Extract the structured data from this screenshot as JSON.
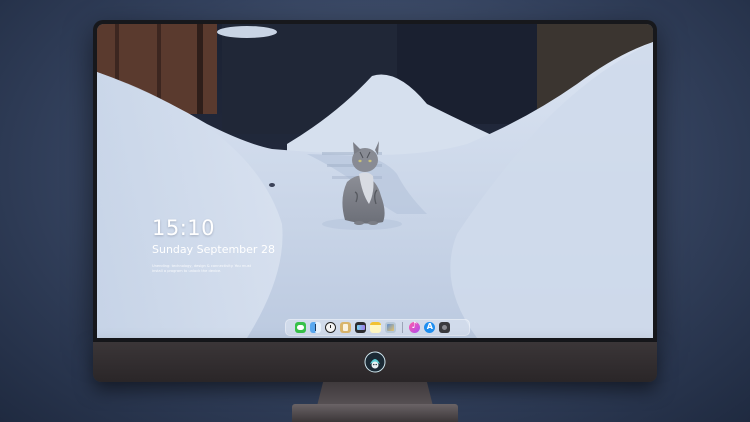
{
  "lock_screen": {
    "time": "15:10",
    "date": "Sunday September 28",
    "notice": "Unending: technology, design & connectivity. You must install a program to unlock the device."
  },
  "dock": {
    "apps": [
      {
        "name": "Messages",
        "icon": "messages-icon"
      },
      {
        "name": "Finder",
        "icon": "finder-icon"
      },
      {
        "name": "Clock",
        "icon": "clock-icon"
      },
      {
        "name": "Contacts",
        "icon": "contacts-icon"
      },
      {
        "name": "Final Cut Pro",
        "icon": "final-cut-icon"
      },
      {
        "name": "Notes",
        "icon": "notes-icon"
      },
      {
        "name": "Preview",
        "icon": "preview-icon"
      },
      {
        "name": "Music",
        "icon": "music-icon"
      },
      {
        "name": "App Store",
        "icon": "app-store-icon"
      },
      {
        "name": "Camera",
        "icon": "camera-icon"
      }
    ]
  },
  "colors": {
    "background": "#3f4e6c",
    "bezel": "#17181c",
    "chin": "#33302f",
    "snow": "#c3d1e6",
    "text": "#ffffff"
  }
}
